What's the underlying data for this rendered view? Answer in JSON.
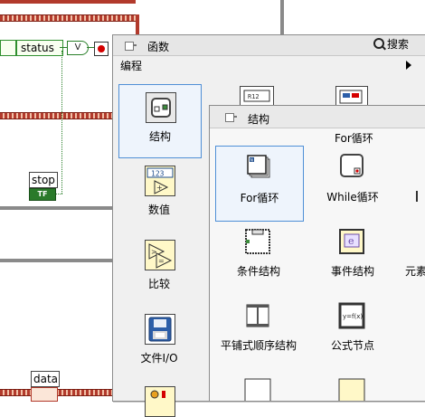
{
  "diagram": {
    "status_label": "status",
    "node_v_label": "V",
    "stop_label": "stop",
    "tf_label": "TF",
    "data_label": "data"
  },
  "palette": {
    "title": "函数",
    "search_label": "搜索",
    "category": "编程",
    "items": [
      {
        "label": "结构",
        "icon": "structures-icon",
        "selected": true
      },
      {
        "label": "数值",
        "icon": "numeric-icon"
      },
      {
        "label": "比较",
        "icon": "comparison-icon"
      },
      {
        "label": "文件I/O",
        "icon": "file-io-icon"
      }
    ]
  },
  "subpalette": {
    "title": "结构",
    "top_partial_label": "For循环",
    "items": [
      {
        "label": "For循环",
        "icon": "for-loop-icon",
        "selected": true
      },
      {
        "label": "While循环",
        "icon": "while-loop-icon"
      },
      {
        "label": "条件结构",
        "icon": "case-structure-icon"
      },
      {
        "label": "事件结构",
        "icon": "event-structure-icon"
      },
      {
        "label": "平铺式顺序结构",
        "icon": "flat-sequence-icon"
      },
      {
        "label": "公式节点",
        "icon": "formula-node-icon"
      }
    ],
    "edge_labels": [
      "元素"
    ]
  },
  "colors": {
    "selection_border": "#4f8fd6",
    "wire_error": "#b23a2c",
    "boolean_green": "#2a7a2a"
  }
}
